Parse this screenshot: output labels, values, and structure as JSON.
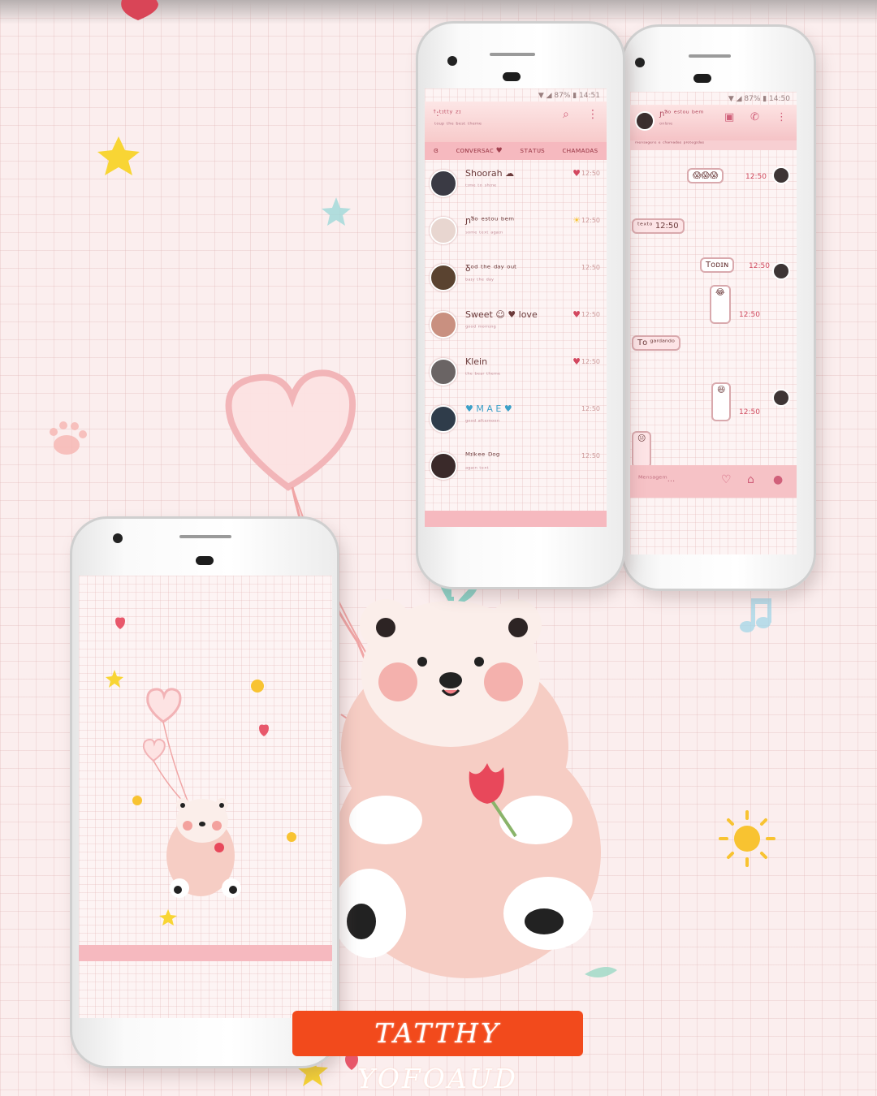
{
  "colors": {
    "accent": "#f6b9bf",
    "brand": "#f24a1c",
    "bear": "#f6cdc4",
    "heart": "#e8586b"
  },
  "watermark": {
    "text": "TATTHY YOFOAUD"
  },
  "chat_list_phone": {
    "status": "▼ ◢ 87% ▮ 14:51",
    "title": "ꜛ:ᵗᶦᵗᵗʸ ᶻᶦ",
    "subtitle": "ᵗᵒᵘᵖ ᵗʰᵉ ᵇᵉˢᵗ ᵗʰᵉᵐᵉ",
    "search_icon": "search-icon",
    "menu_icon": "more-vert-icon",
    "tabs": [
      "ɞ",
      "ᴄᴏɴᴠᴇʀsᴀᴄ ♥",
      "sᴛᴀᴛᴜs",
      "ᴄʜᴀᴍᴀᴅᴀs"
    ],
    "chats": [
      {
        "name": "Shoorah ☁",
        "msg": "ᵗᶦᵐᵉ ᵗᵒ ˢʰᶦⁿᵉ",
        "time": "12:50"
      },
      {
        "name": "ɲᵃ̃ᵒ ᵉˢᵗᵒᵘ ᵇᵉᵐ",
        "msg": "ˢᵒᵐᵉ ᵗᵉˣᵗ ᵃᵍᵃᶦⁿ",
        "time": "12:50"
      },
      {
        "name": "Ᵹᵒᵈ ᵗʰᵉ ᵈᵃʸ ᵒᵘᵗ",
        "msg": "ᵇᵃᶦʸ ᵗʰᵉ ᵈᵃʸ",
        "time": "12:50"
      },
      {
        "name": "Sweet ☺ ♥ love",
        "msg": "ᵍᵒᵒᵈ ᵐᵒʳⁿᶦⁿᵍ",
        "time": "12:50"
      },
      {
        "name": "Klein",
        "msg": "ᵗʰᵉ ᵇᵉᵃʳ ᵗʰᵉᵐᵉ",
        "time": "12:50"
      },
      {
        "name": "♥ M A E ♥",
        "msg": "ᵍᵒᵒᵈ ᵃᶠᵗᵉʳⁿᵒᵒⁿ",
        "time": "12:50"
      },
      {
        "name": "ᴹᶦˡᵏᵉᵉ ᴰᵒᵍ",
        "msg": "ᵃᵍᵃᶦⁿ ᵗᵉˣᵗ",
        "time": "12:50"
      }
    ]
  },
  "conversation_phone": {
    "status": "▼ ◢ 87% ▮ 14:50",
    "name": "ɲᵃ̃ᵒ ᵉˢᵗᵒᵘ ᵇᵉᵐ",
    "presence": "ᵒⁿˡᶦⁿᵉ",
    "subline": "ᵐᵉⁿˢᵃᵍᵉⁿˢ ᵉ ᶜʰᵃᵐᵃᵈᵃˢ ᵖʳᵒᵗᵉᵍᶦᵈᵃˢ",
    "messages": [
      {
        "text": "😱😱😱",
        "time": "12:50",
        "out": true
      },
      {
        "text": "ᵗᵉˣᵗᵒ  12:50",
        "time": "",
        "out": false
      },
      {
        "text": "Tᴏᴅɪɴ",
        "time": "12:50",
        "out": true
      },
      {
        "text": "😂",
        "time": "12:50",
        "out": true
      },
      {
        "text": "Tᴏ ᵍᵃʳᵈᵃⁿᵈᵒ",
        "time": "12:50",
        "out": false
      },
      {
        "text": "😆",
        "time": "12:50",
        "out": true
      },
      {
        "text": "😐",
        "time": "12:50",
        "out": false
      }
    ],
    "input_placeholder": "ᴹᵉⁿˢᵃᵍᵉᵐ..."
  }
}
